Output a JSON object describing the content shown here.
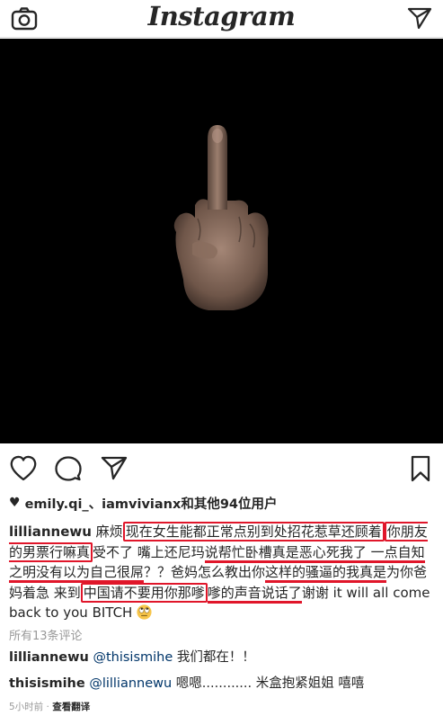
{
  "header": {
    "logo": "Instagram",
    "left_icon": "camera-icon",
    "right_icon": "send-icon"
  },
  "post": {
    "image_icon": "middle-finger-emoji",
    "background_color": "#000000"
  },
  "actions": {
    "like_icon": "heart-outline-icon",
    "comment_icon": "comment-icon",
    "share_icon": "send-icon",
    "save_icon": "bookmark-icon"
  },
  "likes": {
    "heart": "♥",
    "text": "emily.qi_、iamvivianx和其他94位用户"
  },
  "caption": {
    "user": "lilliannewu",
    "seg1": " 麻烦",
    "hl1": "现在女生能都正常点别到处招花惹草还顾着",
    "hl2": "你朋友的男票行嘛真",
    "seg2": "受不了 嘴上还尼玛",
    "ul1": "说帮忙卧槽真是恶心",
    "ul2": "死我了 一点自知之明没有以为自己很屌",
    "seg3": "？？爸妈怎么教出你",
    "ul3": "这样的骚逼的我真是",
    "seg4": "为你爸妈着急 来到",
    "hl3": "中国请不要用你那嗲",
    "ul4": "嗲的声音说话了",
    "seg5": "谢谢 it will all come back to you BITCH",
    "emoji": "rolling-eyes-emoji"
  },
  "all_comments": "所有13条评论",
  "comments": [
    {
      "user": "lilliannewu",
      "mention": "@thisismihe",
      "text": " 我们都在！！"
    },
    {
      "user": "thisismihe",
      "mention": "@lilliannewu",
      "text": " 嗯嗯............ 米盒抱紧姐姐 嘻嘻"
    }
  ],
  "meta": {
    "time": "5小时前",
    "dot": " · ",
    "translate": "查看翻译"
  },
  "colors": {
    "annotation": "#e0162a",
    "mention": "#003569",
    "muted": "#999999"
  }
}
